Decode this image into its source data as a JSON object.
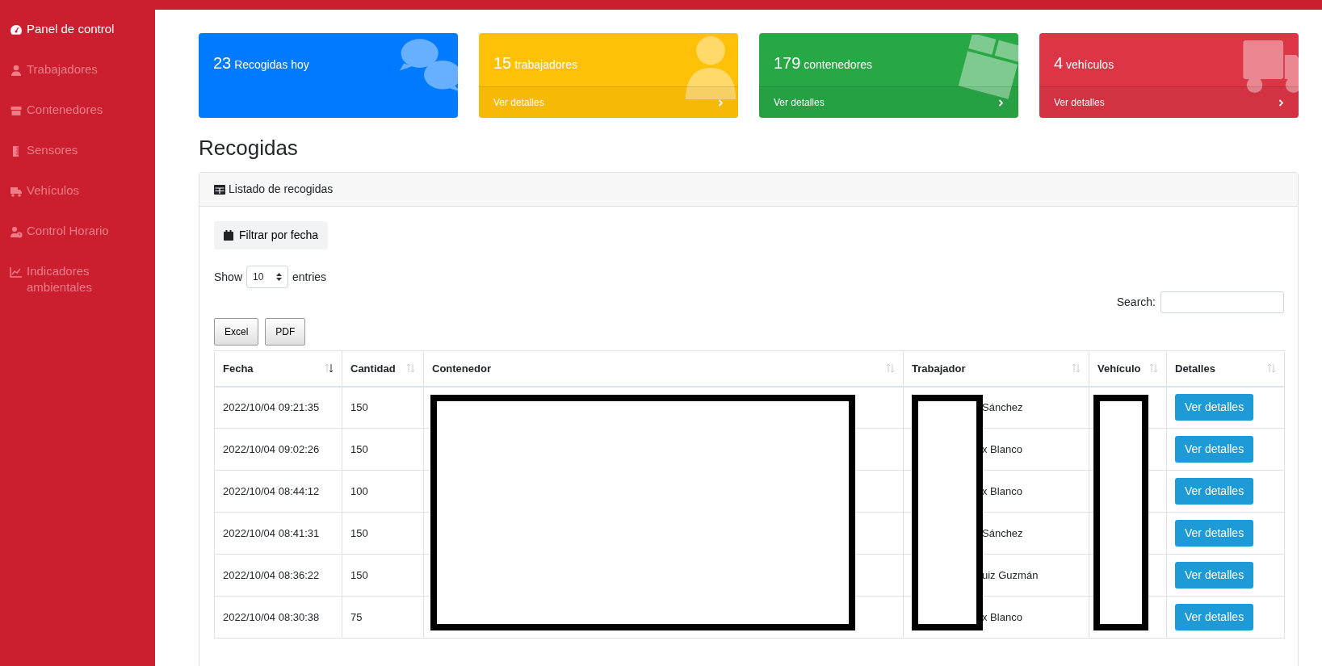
{
  "sidebar": {
    "items": [
      {
        "label": "Panel de control",
        "selected": true
      },
      {
        "label": "Trabajadores",
        "selected": false
      },
      {
        "label": "Contenedores",
        "selected": false
      },
      {
        "label": "Sensores",
        "selected": false
      },
      {
        "label": "Vehículos",
        "selected": false
      },
      {
        "label": "Control Horario",
        "selected": false
      },
      {
        "label": "Indicadores ambientales",
        "selected": false
      }
    ]
  },
  "stat_cards": [
    {
      "value": "23",
      "label": "Recogidas hoy",
      "color": "#007bff"
    },
    {
      "value": "15",
      "label": "trabajadores",
      "color": "#ffc107",
      "link": "Ver detalles"
    },
    {
      "value": "179",
      "label": "contenedores",
      "color": "#28a745",
      "link": "Ver detalles"
    },
    {
      "value": "4",
      "label": "vehículos",
      "color": "#dc3545",
      "link": "Ver detalles"
    }
  ],
  "page_title": "Recogidas",
  "panel": {
    "title": "Listado de recogidas",
    "filter_button": "Filtrar por fecha",
    "length": {
      "before": "Show",
      "value": "10",
      "after": "entries"
    },
    "search": {
      "label": "Search:"
    },
    "export_buttons": [
      "Excel",
      "PDF"
    ],
    "table": {
      "columns": [
        {
          "label": "Fecha",
          "sorted": true
        },
        {
          "label": "Cantidad",
          "sorted": false
        },
        {
          "label": "Contenedor",
          "sorted": false,
          "redacted": true
        },
        {
          "label": "Trabajador",
          "sorted": false,
          "redacted": true
        },
        {
          "label": "Vehículo",
          "sorted": false,
          "redacted": true
        },
        {
          "label": "Detalles",
          "sorted": false
        }
      ],
      "rows": [
        {
          "fecha": "2022/10/04 09:21:35",
          "cantidad": "150",
          "trabajador": "Sánchez",
          "detalles": "Ver detalles"
        },
        {
          "fecha": "2022/10/04 09:02:26",
          "cantidad": "150",
          "trabajador": "x Blanco",
          "detalles": "Ver detalles"
        },
        {
          "fecha": "2022/10/04 08:44:12",
          "cantidad": "100",
          "trabajador": "x Blanco",
          "detalles": "Ver detalles"
        },
        {
          "fecha": "2022/10/04 08:41:31",
          "cantidad": "150",
          "trabajador": "Sánchez",
          "detalles": "Ver detalles"
        },
        {
          "fecha": "2022/10/04 08:36:22",
          "cantidad": "150",
          "trabajador": "uiz Guzmán",
          "detalles": "Ver detalles"
        },
        {
          "fecha": "2022/10/04 08:30:38",
          "cantidad": "75",
          "trabajador": "x Blanco",
          "detalles": "Ver detalles"
        }
      ]
    }
  }
}
